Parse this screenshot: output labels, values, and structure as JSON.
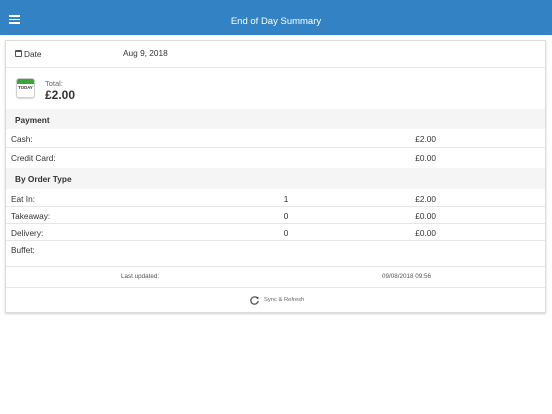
{
  "header": {
    "title": "End of Day Summary",
    "menu_icon": "hamburger-menu-icon"
  },
  "date": {
    "icon": "calendar-icon",
    "label": "Date",
    "value": "Aug 9, 2018"
  },
  "total": {
    "icon": "today-calendar-icon",
    "icon_text": "TODAY",
    "label": "Total:",
    "value": "£2.00"
  },
  "payment": {
    "title": "Payment",
    "rows": [
      {
        "label": "Cash:",
        "amount": "£2.00"
      },
      {
        "label": "Credit Card:",
        "amount": "£0.00"
      }
    ]
  },
  "order_type": {
    "title": "By Order Type",
    "rows": [
      {
        "label": "Eat In:",
        "qty": "1",
        "amount": "£2.00"
      },
      {
        "label": "Takeaway:",
        "qty": "0",
        "amount": "£0.00"
      },
      {
        "label": "Delivery:",
        "qty": "0",
        "amount": "£0.00"
      },
      {
        "label": "Buffet:",
        "qty": "",
        "amount": ""
      }
    ]
  },
  "last_updated": {
    "label": "Last updated:",
    "value": "09/08/2018 09:56"
  },
  "sync": {
    "icon": "refresh-icon",
    "label": "Sync & Refresh"
  },
  "colors": {
    "navbar": "#3382c4",
    "section_background": "#f5f5f5",
    "today_green": "#3aa63a"
  }
}
